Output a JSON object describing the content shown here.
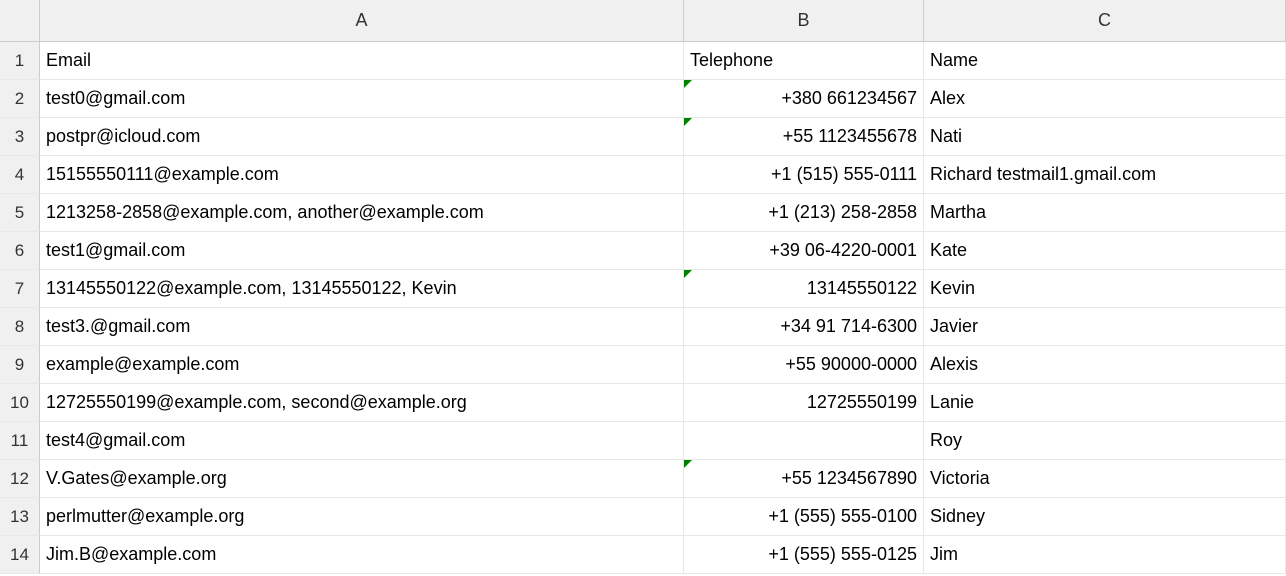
{
  "columns": [
    "A",
    "B",
    "C"
  ],
  "headers": {
    "A": "Email",
    "B": "Telephone",
    "C": "Name"
  },
  "rows": [
    {
      "n": "1"
    },
    {
      "n": "2",
      "A": "test0@gmail.com",
      "B": "+380 661234567",
      "C": "Alex",
      "tri": true
    },
    {
      "n": "3",
      "A": "postpr@icloud.com",
      "B": "+55 1123455678",
      "C": "Nati",
      "tri": true
    },
    {
      "n": "4",
      "A": "15155550111@example.com",
      "B": "+1 (515) 555-0111",
      "C": "Richard testmail1.gmail.com"
    },
    {
      "n": "5",
      "A": "1213258-2858@example.com, another@example.com",
      "B": "+1 (213) 258-2858",
      "C": "Martha"
    },
    {
      "n": "6",
      "A": "test1@gmail.com",
      "B": "+39 06-4220-0001",
      "C": "Kate"
    },
    {
      "n": "7",
      "A": "13145550122@example.com, 13145550122, Kevin",
      "B": "13145550122",
      "C": "Kevin",
      "tri": true
    },
    {
      "n": "8",
      "A": "test3.@gmail.com",
      "B": "+34 91 714-6300",
      "C": "Javier"
    },
    {
      "n": "9",
      "A": "example@example.com",
      "B": "+55 90000-0000",
      "C": "Alexis"
    },
    {
      "n": "10",
      "A": "12725550199@example.com, second@example.org",
      "B": "12725550199",
      "C": "Lanie"
    },
    {
      "n": "11",
      "A": "test4@gmail.com",
      "B": "",
      "C": "Roy"
    },
    {
      "n": "12",
      "A": "V.Gates@example.org",
      "B": "+55 1234567890",
      "C": "Victoria",
      "tri": true
    },
    {
      "n": "13",
      "A": "perlmutter@example.org",
      "B": "+1 (555) 555-0100",
      "C": "Sidney"
    },
    {
      "n": "14",
      "A": "Jim.B@example.com",
      "B": "+1 (555) 555-0125",
      "C": "Jim"
    }
  ]
}
